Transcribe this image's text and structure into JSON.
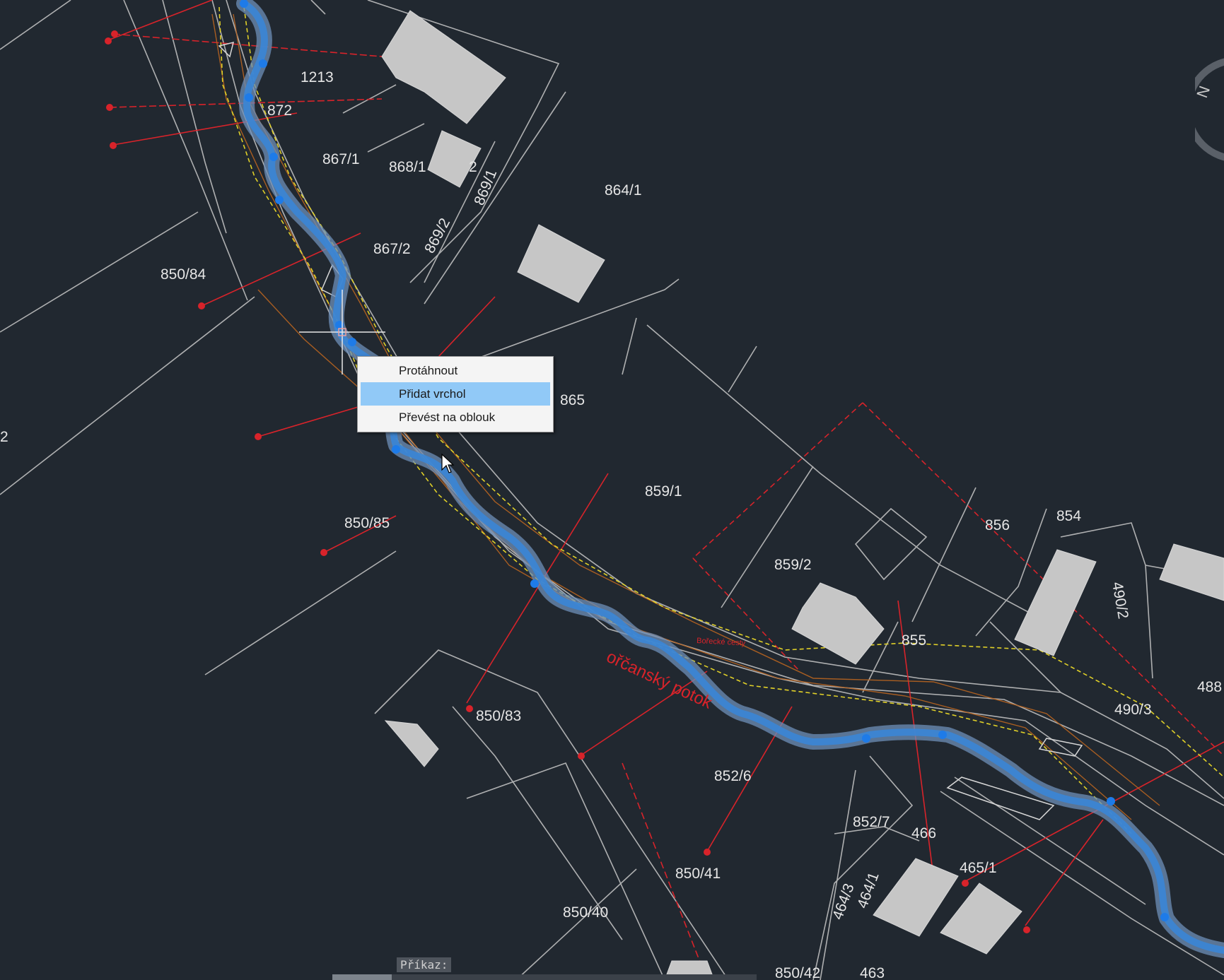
{
  "drawing": {
    "parcel_labels": [
      "1213",
      "872",
      "867/1",
      "868/1",
      "2",
      "869/1",
      "869/2",
      "864/1",
      "867/2",
      "850/84",
      "865",
      "2",
      "859/1",
      "850/85",
      "856",
      "854",
      "859/2",
      "490/2",
      "855",
      "488",
      "490/3",
      "850/83",
      "852/6",
      "852/7",
      "466",
      "465/1",
      "850/41",
      "464/3",
      "464/1",
      "850/40",
      "850/42",
      "463"
    ],
    "stream_name": "ořčanský potok",
    "stream_note": "Bořecké cesty"
  },
  "context_menu": {
    "items": [
      {
        "label": "Protáhnout",
        "selected": false
      },
      {
        "label": "Přidat vrchol",
        "selected": true
      },
      {
        "label": "Převést na oblouk",
        "selected": false
      }
    ]
  },
  "command_line": {
    "prompt": "Příkaz:"
  },
  "viewcube": {
    "compass_letter": "N"
  },
  "colors": {
    "background": "#212830",
    "parcel_lines": "#c8c8c8",
    "red_lines": "#d8232a",
    "yellow_dashed": "#e0d028",
    "orange_contours": "#b86420",
    "polyline_selected": "#3a86d6",
    "polyline_grip": "#1e7be8",
    "buildings": "#c8c8c8",
    "menu_highlight": "#91c9f7"
  }
}
